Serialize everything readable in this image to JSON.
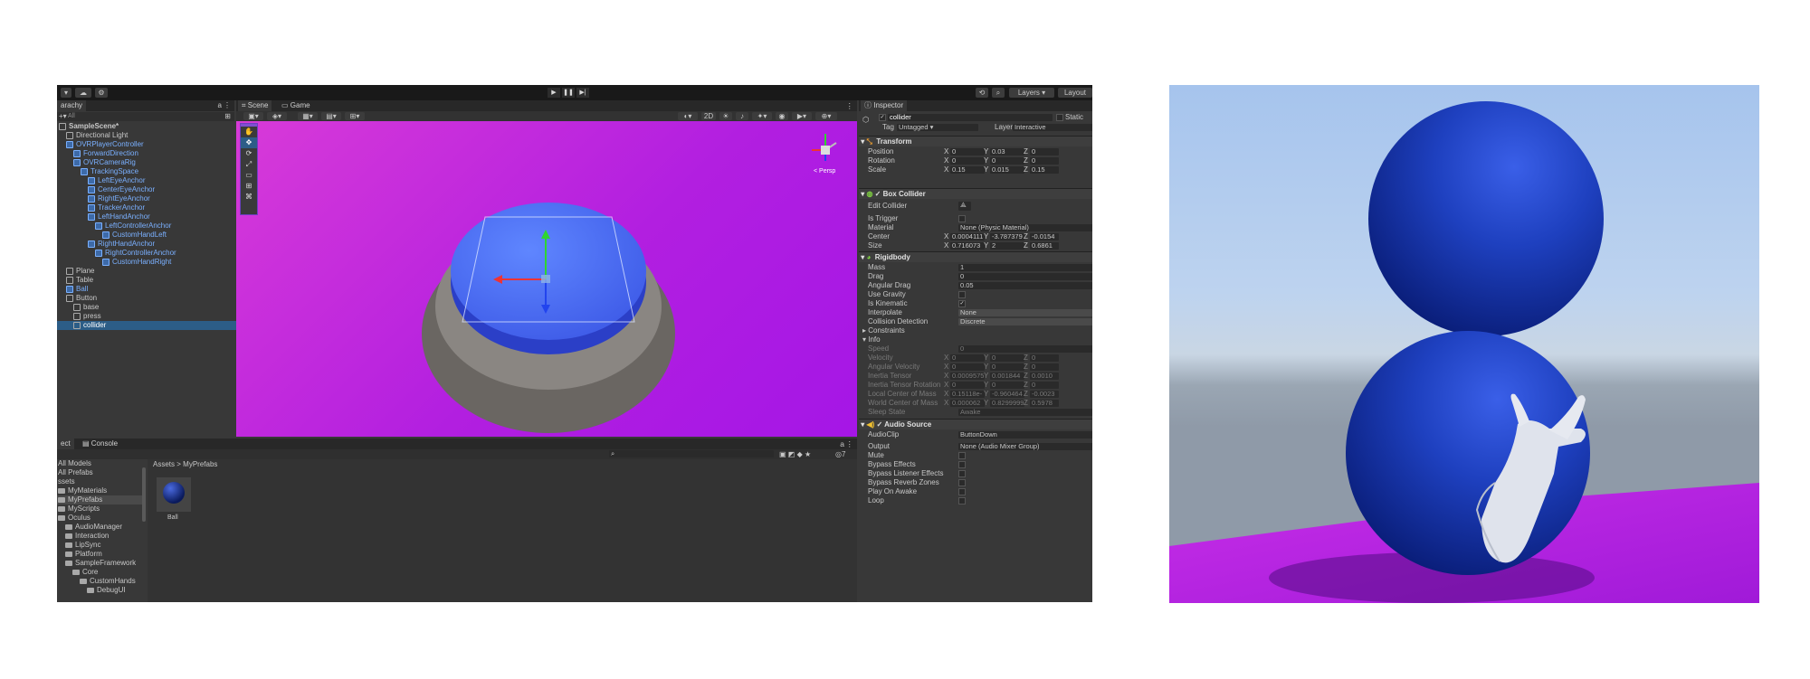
{
  "toolbar": {
    "play_icon": "play-icon",
    "pause_icon": "pause-icon",
    "step_icon": "step-icon",
    "layers_label": "Layers",
    "layout_label": "Layout"
  },
  "hierarchy": {
    "tab_label": "arachy",
    "search_placeholder": "All",
    "items": [
      {
        "label": "SampleScene*",
        "indent": 0,
        "style": "scene"
      },
      {
        "label": "Directional Light",
        "indent": 1
      },
      {
        "label": "OVRPlayerController",
        "indent": 1,
        "style": "prefab"
      },
      {
        "label": "ForwardDirection",
        "indent": 2,
        "style": "prefab"
      },
      {
        "label": "OVRCameraRig",
        "indent": 2,
        "style": "prefab"
      },
      {
        "label": "TrackingSpace",
        "indent": 3,
        "style": "prefab"
      },
      {
        "label": "LeftEyeAnchor",
        "indent": 4,
        "style": "prefab"
      },
      {
        "label": "CenterEyeAnchor",
        "indent": 4,
        "style": "prefab"
      },
      {
        "label": "RightEyeAnchor",
        "indent": 4,
        "style": "prefab"
      },
      {
        "label": "TrackerAnchor",
        "indent": 4,
        "style": "prefab"
      },
      {
        "label": "LeftHandAnchor",
        "indent": 4,
        "style": "prefab"
      },
      {
        "label": "LeftControllerAnchor",
        "indent": 5,
        "style": "prefab"
      },
      {
        "label": "CustomHandLeft",
        "indent": 6,
        "style": "prefab"
      },
      {
        "label": "RightHandAnchor",
        "indent": 4,
        "style": "prefab"
      },
      {
        "label": "RightControllerAnchor",
        "indent": 5,
        "style": "prefab"
      },
      {
        "label": "CustomHandRight",
        "indent": 6,
        "style": "prefab"
      },
      {
        "label": "Plane",
        "indent": 1
      },
      {
        "label": "Table",
        "indent": 1
      },
      {
        "label": "Ball",
        "indent": 1,
        "style": "prefab"
      },
      {
        "label": "Button",
        "indent": 1
      },
      {
        "label": "base",
        "indent": 2
      },
      {
        "label": "press",
        "indent": 2
      },
      {
        "label": "collider",
        "indent": 2,
        "style": "selected"
      }
    ]
  },
  "scene": {
    "tabs": [
      {
        "label": "Scene"
      },
      {
        "label": "Game"
      }
    ],
    "toggle_2d": "2D",
    "gizmo_label": "< Persp"
  },
  "inspector": {
    "tab_label": "Inspector",
    "object_name": "collider",
    "static_label": "Static",
    "tag_label": "Tag",
    "tag_value": "Untagged",
    "layer_label": "Layer",
    "layer_value": "Interactive",
    "transform": {
      "title": "Transform",
      "position": {
        "label": "Position",
        "x": "0",
        "y": "0.03",
        "z": "0"
      },
      "rotation": {
        "label": "Rotation",
        "x": "0",
        "y": "0",
        "z": "0"
      },
      "scale": {
        "label": "Scale",
        "x": "0.15",
        "y": "0.015",
        "z": "0.15"
      }
    },
    "box_collider": {
      "title": "Box Collider",
      "edit_collider": "Edit Collider",
      "is_trigger": "Is Trigger",
      "material_label": "Material",
      "material_value": "None (Physic Material)",
      "center": {
        "label": "Center",
        "x": "0.0004111",
        "y": "-3.787379",
        "z": "-0.0154"
      },
      "size": {
        "label": "Size",
        "x": "0.716073",
        "y": "2",
        "z": "0.6861"
      }
    },
    "rigidbody": {
      "title": "Rigidbody",
      "mass": {
        "label": "Mass",
        "value": "1"
      },
      "drag": {
        "label": "Drag",
        "value": "0"
      },
      "angular_drag": {
        "label": "Angular Drag",
        "value": "0.05"
      },
      "use_gravity": "Use Gravity",
      "is_kinematic": "Is Kinematic",
      "interpolate": {
        "label": "Interpolate",
        "value": "None"
      },
      "collision": {
        "label": "Collision Detection",
        "value": "Discrete"
      },
      "constraints": "Constraints",
      "info": "Info",
      "speed": {
        "label": "Speed",
        "value": "0"
      },
      "velocity": {
        "label": "Velocity",
        "x": "0",
        "y": "0",
        "z": "0"
      },
      "angular_velocity": {
        "label": "Angular Velocity",
        "x": "0",
        "y": "0",
        "z": "0"
      },
      "inertia_tensor": {
        "label": "Inertia Tensor",
        "x": "0.0009575",
        "y": "0.001844",
        "z": "0.0010"
      },
      "inertia_rotation": {
        "label": "Inertia Tensor Rotation",
        "x": "0",
        "y": "0",
        "z": "0"
      },
      "local_com": {
        "label": "Local Center of Mass",
        "x": "0.15118e-",
        "y": "-0.960464",
        "z": "-0.0023"
      },
      "world_com": {
        "label": "World Center of Mass",
        "x": "0.000062",
        "y": "0.8299999",
        "z": "0.5978"
      },
      "sleep_state": {
        "label": "Sleep State",
        "value": "Awake"
      }
    },
    "audio_source": {
      "title": "Audio Source",
      "clip": {
        "label": "AudioClip",
        "value": "ButtonDown"
      },
      "output": {
        "label": "Output",
        "value": "None (Audio Mixer Group)"
      },
      "mute": "Mute",
      "bypass_effects": "Bypass Effects",
      "bypass_listener": "Bypass Listener Effects",
      "bypass_reverb": "Bypass Reverb Zones",
      "play_on_awake": "Play On Awake",
      "loop": "Loop"
    }
  },
  "project": {
    "tabs": [
      {
        "label": "ect"
      },
      {
        "label": "Console"
      }
    ],
    "breadcrumb_root": "Assets",
    "breadcrumb_sep": ">",
    "breadcrumb_current": "MyPrefabs",
    "tree": [
      {
        "label": "All Models",
        "indent": 0
      },
      {
        "label": "All Prefabs",
        "indent": 0
      },
      {
        "label": "ssets",
        "indent": 0
      },
      {
        "label": "MyMaterials",
        "indent": 0
      },
      {
        "label": "MyPrefabs",
        "indent": 0,
        "selected": true
      },
      {
        "label": "MyScripts",
        "indent": 0
      },
      {
        "label": "Oculus",
        "indent": 0
      },
      {
        "label": "AudioManager",
        "indent": 1
      },
      {
        "label": "Interaction",
        "indent": 1
      },
      {
        "label": "LipSync",
        "indent": 1
      },
      {
        "label": "Platform",
        "indent": 1
      },
      {
        "label": "SampleFramework",
        "indent": 1
      },
      {
        "label": "Core",
        "indent": 2
      },
      {
        "label": "CustomHands",
        "indent": 3
      },
      {
        "label": "DebugUI",
        "indent": 4
      }
    ],
    "asset_name": "Ball",
    "count_label": "7"
  },
  "colors": {
    "accent": "#2c5d87",
    "viewport": "#b21fe0",
    "ball": "#1d3fb4"
  }
}
